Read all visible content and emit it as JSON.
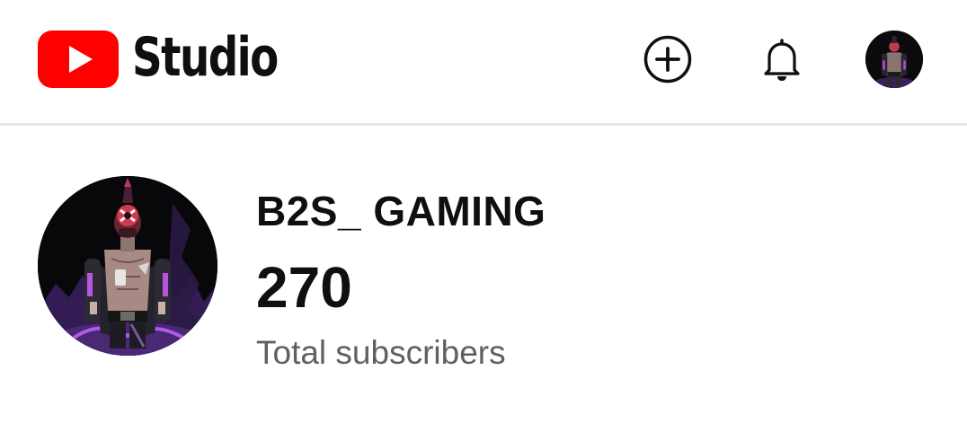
{
  "header": {
    "brand": "Studio",
    "icons": {
      "logo": "youtube-logo-icon",
      "create": "create-plus-icon",
      "notifications": "bell-icon",
      "account": "account-avatar"
    }
  },
  "channel": {
    "name": "B2S_ GAMING",
    "subscriber_count": "270",
    "subscriber_label": "Total subscribers"
  },
  "colors": {
    "youtube_red": "#ff0000",
    "text_primary": "#0f0f0f",
    "text_secondary": "#606060",
    "divider": "#e5e5e5"
  }
}
